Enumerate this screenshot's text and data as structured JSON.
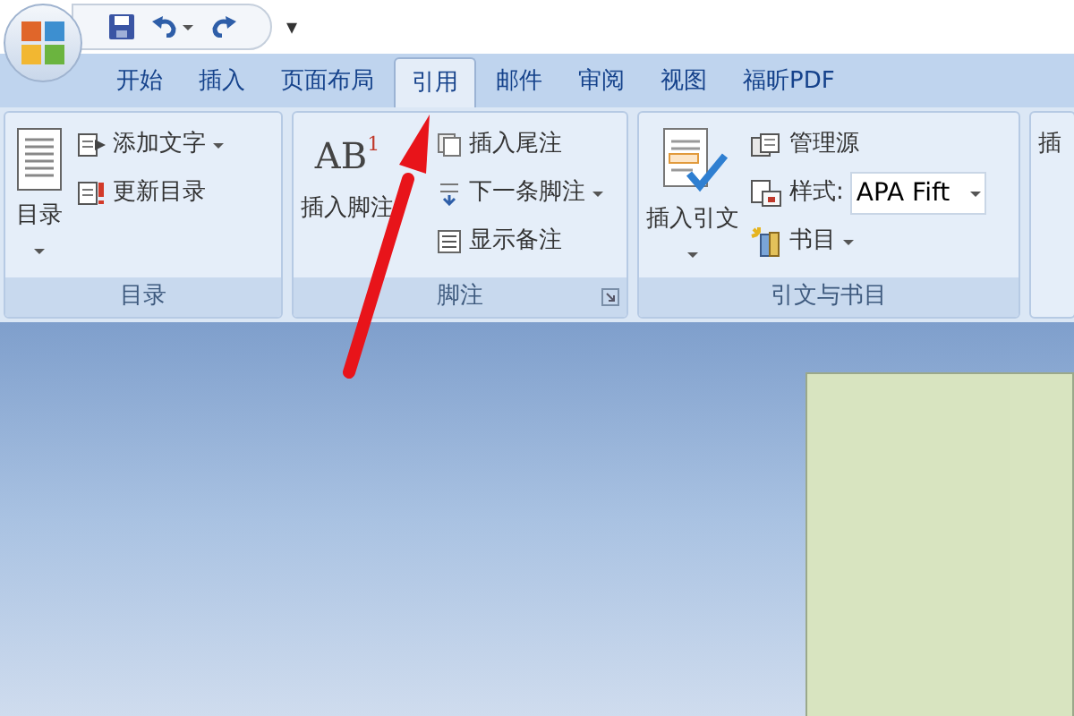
{
  "quick_access": {
    "customize": "▾"
  },
  "tabs": [
    {
      "label": "开始",
      "selected": false
    },
    {
      "label": "插入",
      "selected": false
    },
    {
      "label": "页面布局",
      "selected": false
    },
    {
      "label": "引用",
      "selected": true
    },
    {
      "label": "邮件",
      "selected": false
    },
    {
      "label": "审阅",
      "selected": false
    },
    {
      "label": "视图",
      "selected": false
    },
    {
      "label": "福昕PDF",
      "selected": false
    }
  ],
  "groups": [
    {
      "title": "目录",
      "launcher": false,
      "large": {
        "label": "目录",
        "dropdown": true
      },
      "small": [
        {
          "kind": "button",
          "label": "添加文字",
          "dropdown": true
        },
        {
          "kind": "button",
          "label": "更新目录",
          "dropdown": false
        }
      ]
    },
    {
      "title": "脚注",
      "launcher": true,
      "large": {
        "label": "插入脚注",
        "icon_text": "AB",
        "icon_superscript": "1",
        "dropdown": false
      },
      "small": [
        {
          "kind": "button",
          "label": "插入尾注",
          "dropdown": false
        },
        {
          "kind": "button",
          "label": "下一条脚注",
          "dropdown": true
        },
        {
          "kind": "button",
          "label": "显示备注",
          "dropdown": false
        }
      ]
    },
    {
      "title": "引文与书目",
      "launcher": false,
      "large": {
        "label": "插入引文",
        "dropdown": true
      },
      "small": [
        {
          "kind": "button",
          "label": "管理源",
          "dropdown": false
        },
        {
          "kind": "combo",
          "label": "样式:",
          "value": "APA Fift"
        },
        {
          "kind": "button",
          "label": "书目",
          "dropdown": true
        }
      ]
    },
    {
      "large": {
        "label": "插"
      }
    }
  ]
}
